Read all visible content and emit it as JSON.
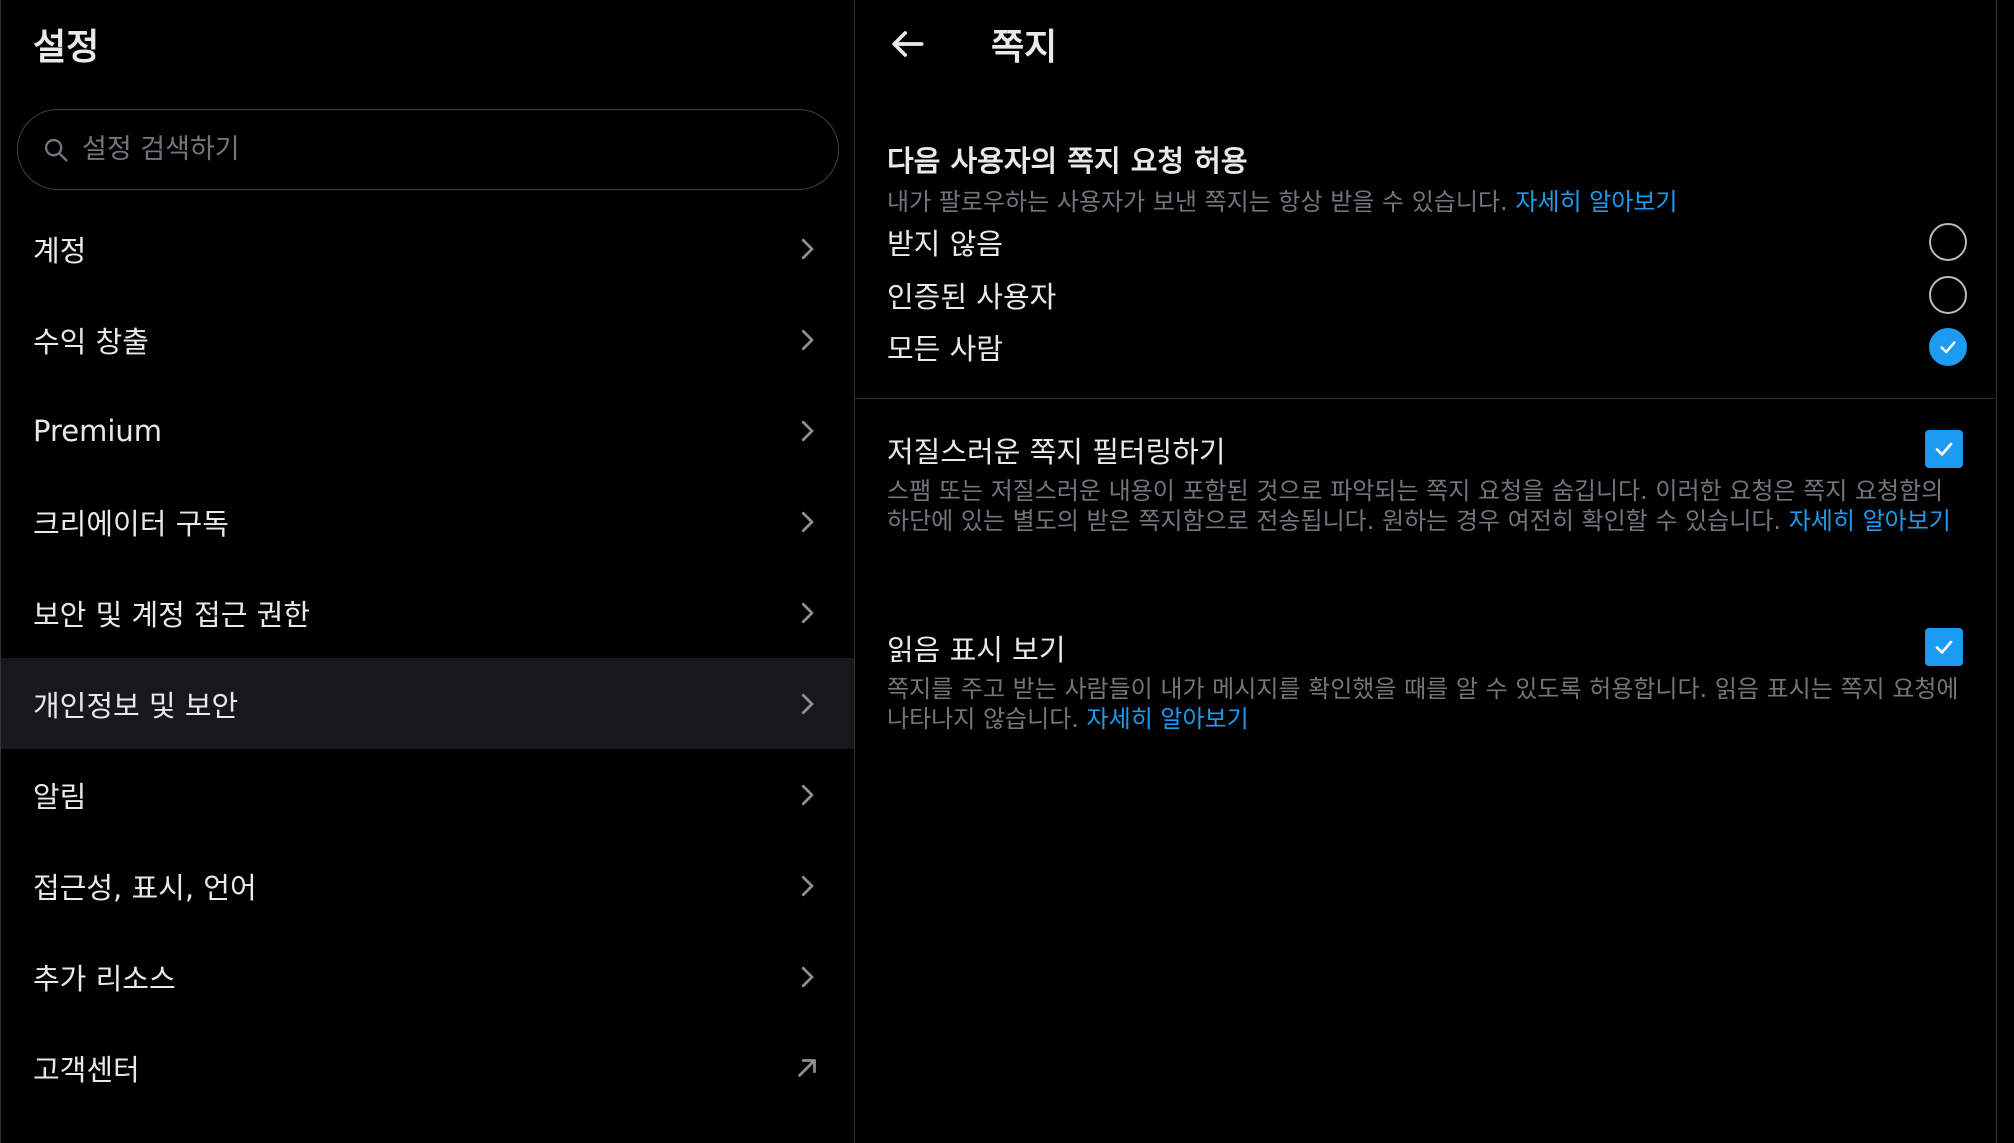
{
  "left": {
    "title": "설정",
    "search": {
      "placeholder": "설정 검색하기"
    },
    "items": [
      {
        "label": "계정"
      },
      {
        "label": "수익 창출"
      },
      {
        "label": "Premium"
      },
      {
        "label": "크리에이터 구독"
      },
      {
        "label": "보안 및 계정 접근 권한"
      },
      {
        "label": "개인정보 및 보안"
      },
      {
        "label": "알림"
      },
      {
        "label": "접근성, 표시, 언어"
      },
      {
        "label": "추가 리소스"
      },
      {
        "label": "고객센터"
      }
    ],
    "active_item": "개인정보 및 보안"
  },
  "right": {
    "title": "쪽지",
    "request_section": {
      "title": "다음 사용자의 쪽지 요청 허용",
      "description": "내가 팔로우하는 사용자가 보낸 쪽지는 항상 받을 수 있습니다.",
      "link": "자세히 알아보기",
      "options": [
        {
          "label": "받지 않음",
          "selected": false
        },
        {
          "label": "인증된 사용자",
          "selected": false
        },
        {
          "label": "모든 사람",
          "selected": true
        }
      ]
    },
    "filter": {
      "title": "저질스러운 쪽지 필터링하기",
      "description": "스팸 또는 저질스러운 내용이 포함된 것으로 파악되는 쪽지 요청을 숨깁니다. 이러한 요청은 쪽지 요청함의 하단에 있는 별도의 받은 쪽지함으로 전송됩니다. 원하는 경우 여전히 확인할 수 있습니다.",
      "link": "자세히 알아보기",
      "checked": true
    },
    "read_receipts": {
      "title": "읽음 표시 보기",
      "description": "쪽지를 주고 받는 사람들이 내가 메시지를 확인했을 때를 알 수 있도록 허용합니다. 읽음 표시는 쪽지 요청에 나타나지 않습니다.",
      "link": "자세히 알아보기",
      "checked": true
    }
  },
  "colors": {
    "accent": "#1d9bf0",
    "muted": "#71767b",
    "text": "#e7e9ea",
    "border": "#2f3336"
  }
}
